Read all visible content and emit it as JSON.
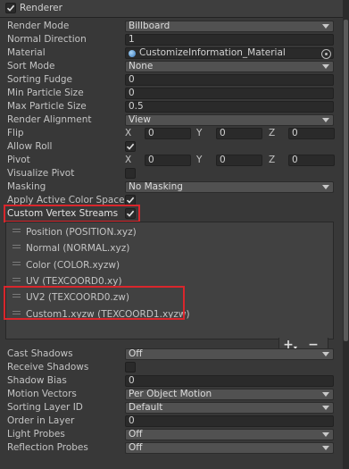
{
  "header": {
    "title": "Renderer",
    "enabled": true
  },
  "render_mode": {
    "label": "Render Mode",
    "value": "Billboard"
  },
  "normal_direction": {
    "label": "Normal Direction",
    "value": "1"
  },
  "material": {
    "label": "Material",
    "value": "CustomizeInformation_Material"
  },
  "sort_mode": {
    "label": "Sort Mode",
    "value": "None"
  },
  "sorting_fudge": {
    "label": "Sorting Fudge",
    "value": "0"
  },
  "min_particle_size": {
    "label": "Min Particle Size",
    "value": "0"
  },
  "max_particle_size": {
    "label": "Max Particle Size",
    "value": "0.5"
  },
  "render_alignment": {
    "label": "Render Alignment",
    "value": "View"
  },
  "flip": {
    "label": "Flip",
    "x_label": "X",
    "x": "0",
    "y_label": "Y",
    "y": "0",
    "z_label": "Z",
    "z": "0"
  },
  "allow_roll": {
    "label": "Allow Roll",
    "checked": true
  },
  "pivot": {
    "label": "Pivot",
    "x_label": "X",
    "x": "0",
    "y_label": "Y",
    "y": "0",
    "z_label": "Z",
    "z": "0"
  },
  "visualize_pivot": {
    "label": "Visualize Pivot",
    "checked": false
  },
  "masking": {
    "label": "Masking",
    "value": "No Masking"
  },
  "apply_active_color_space": {
    "label": "Apply Active Color Space",
    "checked": true
  },
  "custom_vertex_streams": {
    "label": "Custom Vertex Streams",
    "checked": true
  },
  "streams": [
    {
      "text": "Position (POSITION.xyz)"
    },
    {
      "text": "Normal (NORMAL.xyz)"
    },
    {
      "text": "Color (COLOR.xyzw)"
    },
    {
      "text": "UV (TEXCOORD0.xy)"
    },
    {
      "text": "UV2 (TEXCOORD0.zw)"
    },
    {
      "text": "Custom1.xyzw (TEXCOORD1.xyzw)"
    }
  ],
  "streams_footer": {
    "add": "+",
    "add_arrow": "▾",
    "remove": "−"
  },
  "cast_shadows": {
    "label": "Cast Shadows",
    "value": "Off"
  },
  "receive_shadows": {
    "label": "Receive Shadows",
    "checked": false
  },
  "shadow_bias": {
    "label": "Shadow Bias",
    "value": "0"
  },
  "motion_vectors": {
    "label": "Motion Vectors",
    "value": "Per Object Motion"
  },
  "sorting_layer_id": {
    "label": "Sorting Layer ID",
    "value": "Default"
  },
  "order_in_layer": {
    "label": "Order in Layer",
    "value": "0"
  },
  "light_probes": {
    "label": "Light Probes",
    "value": "Off"
  },
  "reflection_probes": {
    "label": "Reflection Probes",
    "value": "Off"
  },
  "colors": {
    "background": "#383838",
    "highlight": "#d9262c",
    "field": "#2a2a2a",
    "dropdown": "#515151"
  }
}
